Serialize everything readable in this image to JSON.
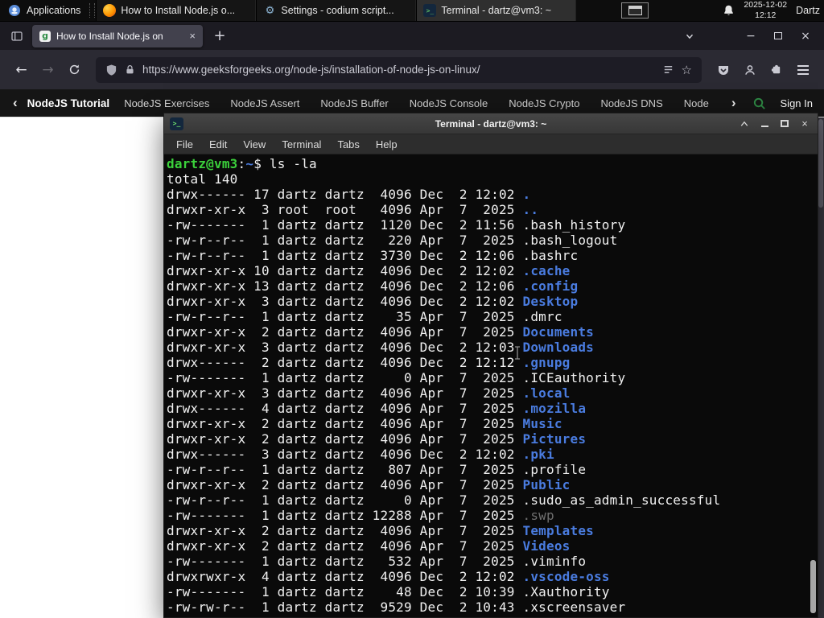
{
  "panel": {
    "applications": "Applications",
    "taskbar": [
      {
        "title": "How to Install Node.js o...",
        "icon": "firefox",
        "active": false
      },
      {
        "title": "Settings - codium script...",
        "icon": "gear",
        "active": false
      },
      {
        "title": "Terminal - dartz@vm3: ~",
        "icon": "terminal",
        "active": true
      }
    ],
    "date": "2025-12-02",
    "time": "12:12",
    "user": "Dartz"
  },
  "browser": {
    "tab_title": "How to Install Node.js on",
    "url": "https://www.geeksforgeeks.org/node-js/installation-of-node-js-on-linux/",
    "sitenav": {
      "primary": "NodeJS Tutorial",
      "items": [
        "NodeJS Exercises",
        "NodeJS Assert",
        "NodeJS Buffer",
        "NodeJS Console",
        "NodeJS Crypto",
        "NodeJS DNS",
        "Node"
      ],
      "sign_in": "Sign In"
    }
  },
  "terminal_window": {
    "title": "Terminal - dartz@vm3: ~",
    "menu": [
      "File",
      "Edit",
      "View",
      "Terminal",
      "Tabs",
      "Help"
    ],
    "prompt_user_host": "dartz@vm3",
    "prompt_separator": ":",
    "prompt_cwd": "~",
    "prompt_symbol": "$ ",
    "command": "ls -la",
    "total": "total 140",
    "listing": [
      {
        "meta": "drwx------ 17 dartz dartz  4096 Dec  2 12:02 ",
        "name": ".",
        "kind": "dir"
      },
      {
        "meta": "drwxr-xr-x  3 root  root   4096 Apr  7  2025 ",
        "name": "..",
        "kind": "dir"
      },
      {
        "meta": "-rw-------  1 dartz dartz  1120 Dec  2 11:56 ",
        "name": ".bash_history",
        "kind": "file"
      },
      {
        "meta": "-rw-r--r--  1 dartz dartz   220 Apr  7  2025 ",
        "name": ".bash_logout",
        "kind": "file"
      },
      {
        "meta": "-rw-r--r--  1 dartz dartz  3730 Dec  2 12:06 ",
        "name": ".bashrc",
        "kind": "file"
      },
      {
        "meta": "drwxr-xr-x 10 dartz dartz  4096 Dec  2 12:02 ",
        "name": ".cache",
        "kind": "dir"
      },
      {
        "meta": "drwxr-xr-x 13 dartz dartz  4096 Dec  2 12:06 ",
        "name": ".config",
        "kind": "dir"
      },
      {
        "meta": "drwxr-xr-x  3 dartz dartz  4096 Dec  2 12:02 ",
        "name": "Desktop",
        "kind": "dir"
      },
      {
        "meta": "-rw-r--r--  1 dartz dartz    35 Apr  7  2025 ",
        "name": ".dmrc",
        "kind": "file"
      },
      {
        "meta": "drwxr-xr-x  2 dartz dartz  4096 Apr  7  2025 ",
        "name": "Documents",
        "kind": "dir"
      },
      {
        "meta": "drwxr-xr-x  3 dartz dartz  4096 Dec  2 12:03 ",
        "name": "Downloads",
        "kind": "dir"
      },
      {
        "meta": "drwx------  2 dartz dartz  4096 Dec  2 12:12 ",
        "name": ".gnupg",
        "kind": "dir"
      },
      {
        "meta": "-rw-------  1 dartz dartz     0 Apr  7  2025 ",
        "name": ".ICEauthority",
        "kind": "file"
      },
      {
        "meta": "drwxr-xr-x  3 dartz dartz  4096 Apr  7  2025 ",
        "name": ".local",
        "kind": "dir"
      },
      {
        "meta": "drwx------  4 dartz dartz  4096 Apr  7  2025 ",
        "name": ".mozilla",
        "kind": "dir"
      },
      {
        "meta": "drwxr-xr-x  2 dartz dartz  4096 Apr  7  2025 ",
        "name": "Music",
        "kind": "dir"
      },
      {
        "meta": "drwxr-xr-x  2 dartz dartz  4096 Apr  7  2025 ",
        "name": "Pictures",
        "kind": "dir"
      },
      {
        "meta": "drwx------  3 dartz dartz  4096 Dec  2 12:02 ",
        "name": ".pki",
        "kind": "dir"
      },
      {
        "meta": "-rw-r--r--  1 dartz dartz   807 Apr  7  2025 ",
        "name": ".profile",
        "kind": "file"
      },
      {
        "meta": "drwxr-xr-x  2 dartz dartz  4096 Apr  7  2025 ",
        "name": "Public",
        "kind": "dir"
      },
      {
        "meta": "-rw-r--r--  1 dartz dartz     0 Apr  7  2025 ",
        "name": ".sudo_as_admin_successful",
        "kind": "file"
      },
      {
        "meta": "-rw-------  1 dartz dartz 12288 Apr  7  2025 ",
        "name": ".swp",
        "kind": "dim"
      },
      {
        "meta": "drwxr-xr-x  2 dartz dartz  4096 Apr  7  2025 ",
        "name": "Templates",
        "kind": "dir"
      },
      {
        "meta": "drwxr-xr-x  2 dartz dartz  4096 Apr  7  2025 ",
        "name": "Videos",
        "kind": "dir"
      },
      {
        "meta": "-rw-------  1 dartz dartz   532 Apr  7  2025 ",
        "name": ".viminfo",
        "kind": "file"
      },
      {
        "meta": "drwxrwxr-x  4 dartz dartz  4096 Dec  2 12:02 ",
        "name": ".vscode-oss",
        "kind": "dir"
      },
      {
        "meta": "-rw-------  1 dartz dartz    48 Dec  2 10:39 ",
        "name": ".Xauthority",
        "kind": "file"
      },
      {
        "meta": "-rw-rw-r--  1 dartz dartz  9529 Dec  2 10:43 ",
        "name": ".xscreensaver",
        "kind": "file"
      }
    ]
  },
  "icons": {
    "close": "×",
    "minimize": "−",
    "new_tab": "+",
    "chevron_left": "‹",
    "chevron_right": "›",
    "back": "←",
    "forward": "→",
    "star": "☆",
    "gear": "⚙",
    "terminal_glyph": ">_",
    "favicon_letter": "g"
  },
  "colors": {
    "gfg_green": "#2f8d46",
    "prompt_green": "#3bd13b",
    "dir_blue": "#4a7ce0",
    "dim_gray": "#6f6f6f"
  }
}
